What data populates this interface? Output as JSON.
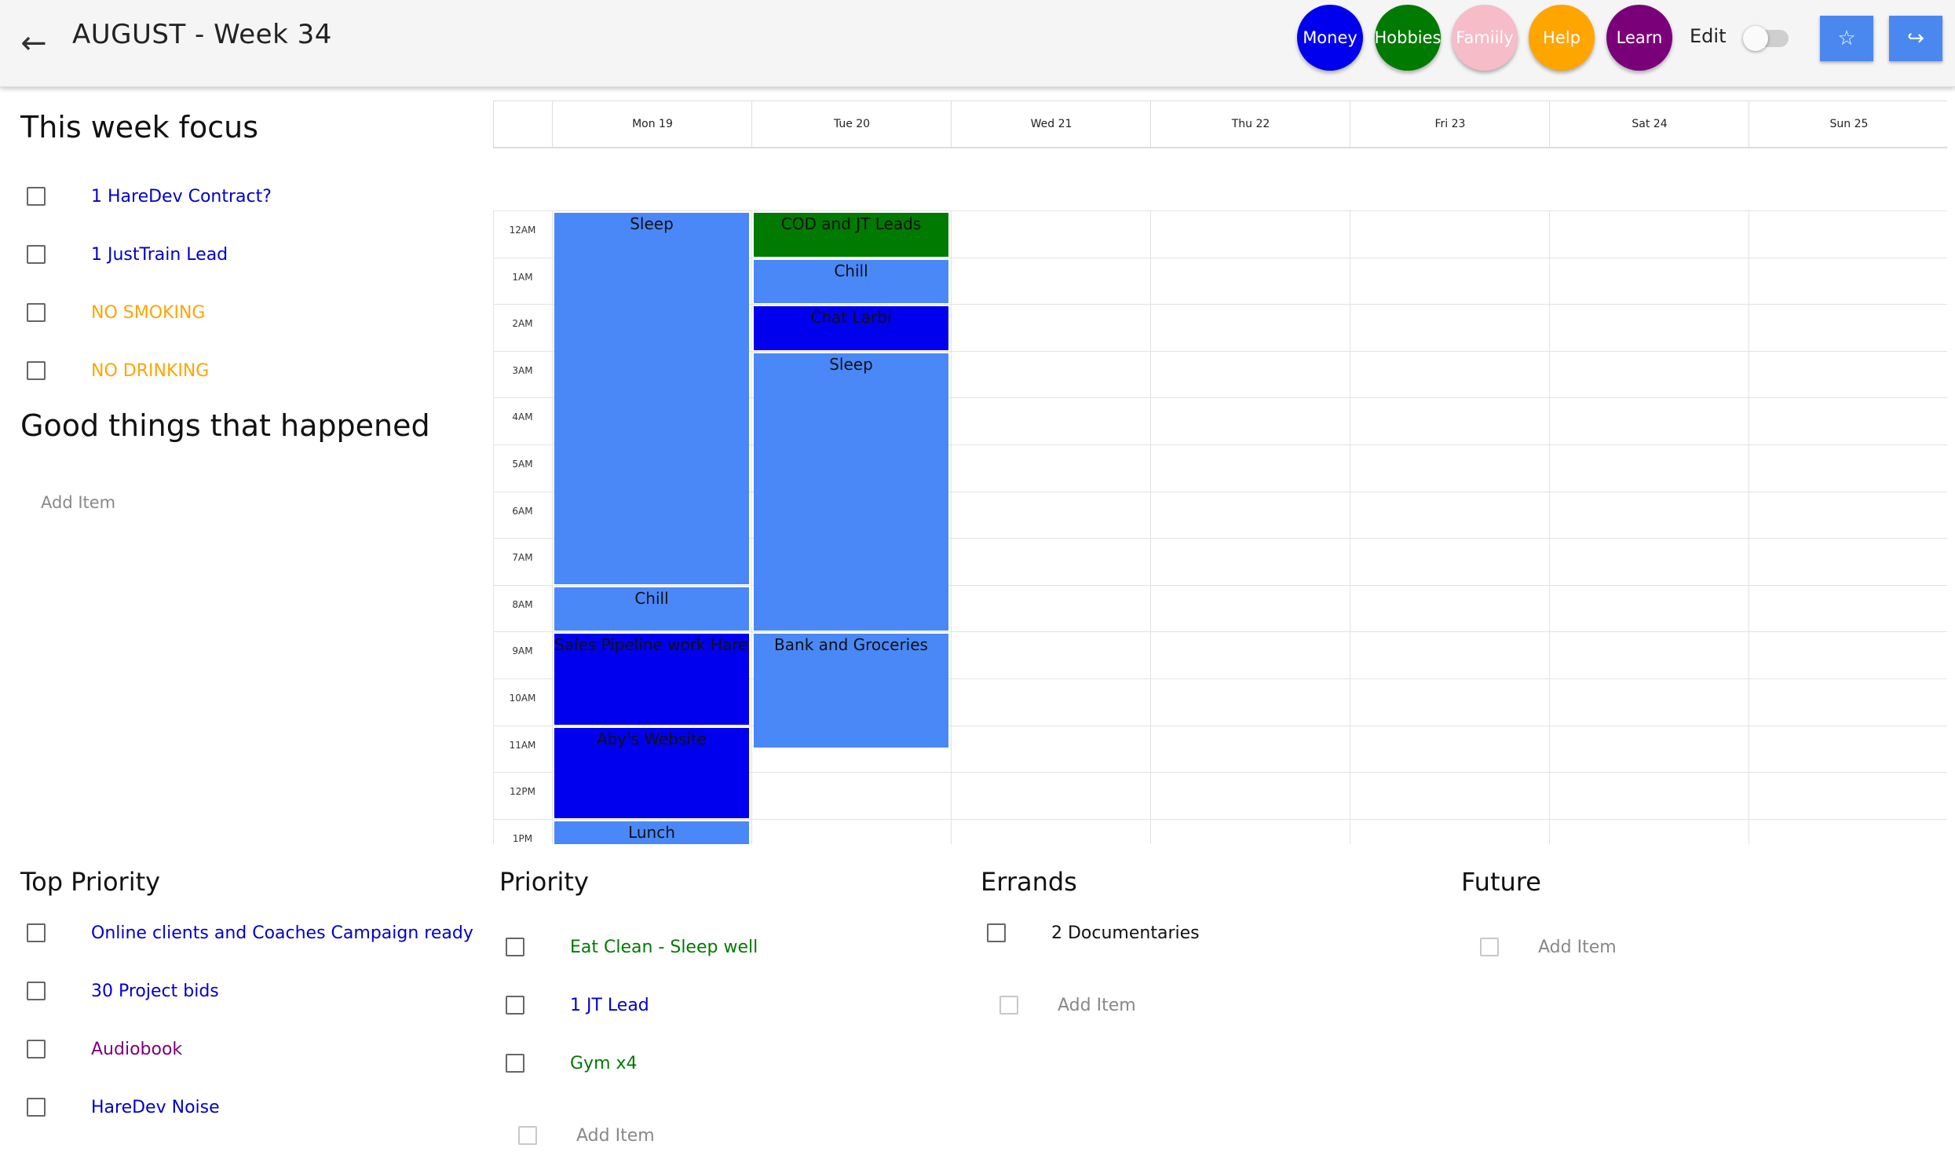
{
  "header": {
    "title": "AUGUST - Week 34",
    "back_icon": "←",
    "categories": [
      {
        "label": "Money",
        "color": "#0000ee"
      },
      {
        "label": "Hobbies",
        "color": "#007a00"
      },
      {
        "label": "Famiily",
        "color": "#f6bcc8"
      },
      {
        "label": "Help",
        "color": "#ffa500"
      },
      {
        "label": "Learn",
        "color": "#7a007a"
      }
    ],
    "edit_label": "Edit",
    "star_icon": "☆",
    "exit_icon": "↪"
  },
  "focus": {
    "title": "This week focus",
    "items": [
      {
        "text": "1 HareDev Contract?",
        "color": "#0000cc"
      },
      {
        "text": "1 JustTrain Lead",
        "color": "#0000cc"
      },
      {
        "text": "NO SMOKING",
        "color": "#ffa500"
      },
      {
        "text": "NO DRINKING",
        "color": "#ffa500"
      }
    ]
  },
  "good_things": {
    "title": "Good things that happened",
    "add_label": "Add Item"
  },
  "calendar": {
    "days": [
      "Mon 19",
      "Tue 20",
      "Wed 21",
      "Thu 22",
      "Fri 23",
      "Sat 24",
      "Sun 25"
    ],
    "hours": [
      "12AM",
      "1AM",
      "2AM",
      "3AM",
      "4AM",
      "5AM",
      "6AM",
      "7AM",
      "8AM",
      "9AM",
      "10AM",
      "11AM",
      "12PM",
      "1PM"
    ],
    "events": [
      {
        "day": 0,
        "start": 0,
        "end": 8,
        "title": "Sleep",
        "color": "#4a88f8"
      },
      {
        "day": 0,
        "start": 8,
        "end": 9,
        "title": "Chill",
        "color": "#4a88f8"
      },
      {
        "day": 0,
        "start": 9,
        "end": 11,
        "title": "Sales Pipeline work HareDev",
        "color": "#0000ee"
      },
      {
        "day": 0,
        "start": 11,
        "end": 13,
        "title": "Aby's Website",
        "color": "#0000ee"
      },
      {
        "day": 0,
        "start": 13,
        "end": 14,
        "title": "Lunch",
        "color": "#4a88f8"
      },
      {
        "day": 1,
        "start": 0,
        "end": 1,
        "title": "COD and JT Leads",
        "color": "#007a00"
      },
      {
        "day": 1,
        "start": 1,
        "end": 2,
        "title": "Chill",
        "color": "#4a88f8"
      },
      {
        "day": 1,
        "start": 2,
        "end": 3,
        "title": "Chat Larbi",
        "color": "#0000ee"
      },
      {
        "day": 1,
        "start": 3,
        "end": 9,
        "title": "Sleep",
        "color": "#4a88f8"
      },
      {
        "day": 1,
        "start": 9,
        "end": 11.5,
        "title": "Bank and Groceries",
        "color": "#4a88f8"
      }
    ]
  },
  "lists": [
    {
      "title": "Top Priority",
      "items": [
        {
          "text": "Online clients and Coaches Campaign ready",
          "color": "#0000cc"
        },
        {
          "text": "30 Project bids",
          "color": "#0000cc"
        },
        {
          "text": "Audiobook",
          "color": "#7a007a"
        },
        {
          "text": "HareDev Noise",
          "color": "#0000cc"
        }
      ],
      "add_label": ""
    },
    {
      "title": "Priority",
      "items": [
        {
          "text": "Eat Clean - Sleep well",
          "color": "#007a00"
        },
        {
          "text": "1 JT Lead",
          "color": "#0000cc"
        },
        {
          "text": "Gym x4",
          "color": "#007a00"
        }
      ],
      "add_label": "Add Item"
    },
    {
      "title": "Errands",
      "items": [
        {
          "text": "2 Documentaries",
          "color": "#111111"
        }
      ],
      "add_label": "Add Item"
    },
    {
      "title": "Future",
      "items": [],
      "add_label": "Add Item"
    }
  ]
}
